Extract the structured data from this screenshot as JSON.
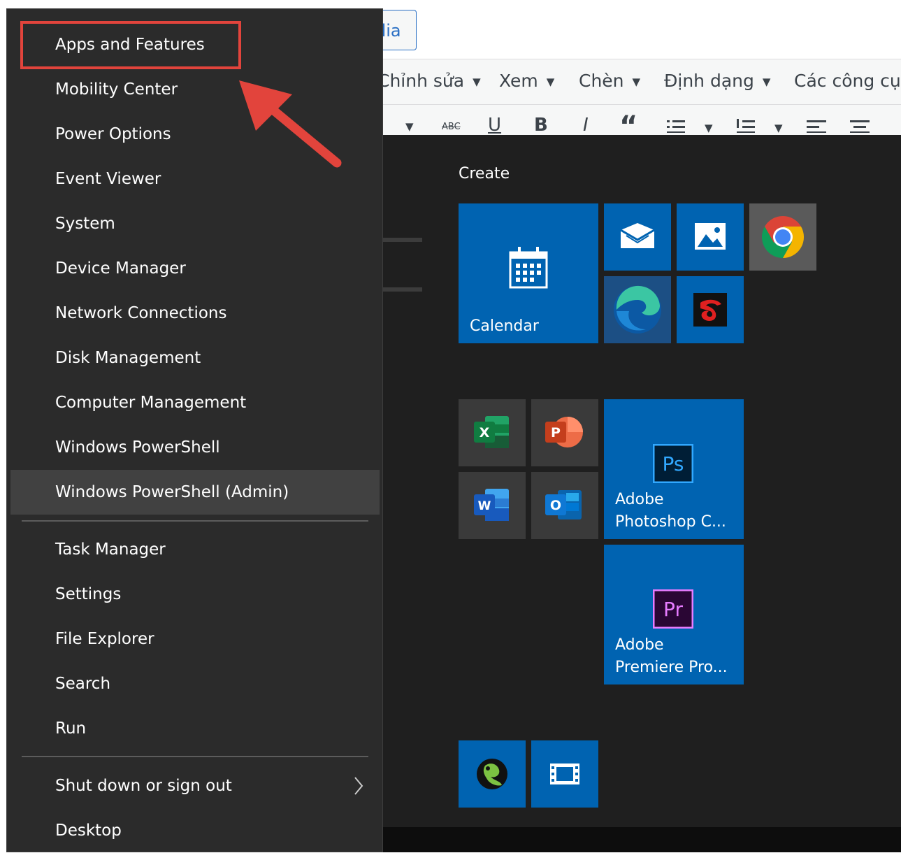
{
  "editor": {
    "media_button": "dia",
    "menu": [
      "Chỉnh sửa",
      "Xem",
      "Chèn",
      "Định dạng",
      "Các công cụ"
    ],
    "toolbar": [
      "ABC",
      "U",
      "B",
      "I",
      "“"
    ]
  },
  "context_menu": {
    "items": [
      {
        "label": "Apps and Features"
      },
      {
        "label": "Mobility Center"
      },
      {
        "label": "Power Options"
      },
      {
        "label": "Event Viewer"
      },
      {
        "label": "System"
      },
      {
        "label": "Device Manager"
      },
      {
        "label": "Network Connections"
      },
      {
        "label": "Disk Management"
      },
      {
        "label": "Computer Management"
      },
      {
        "label": "Windows PowerShell"
      },
      {
        "label": "Windows PowerShell (Admin)"
      },
      {
        "label": "Task Manager"
      },
      {
        "label": "Settings"
      },
      {
        "label": "File Explorer"
      },
      {
        "label": "Search"
      },
      {
        "label": "Run"
      },
      {
        "label": "Shut down or sign out"
      },
      {
        "label": "Desktop"
      }
    ],
    "hovered_item": "Windows PowerShell (Admin)",
    "highlighted_item": "Apps and Features"
  },
  "start_menu": {
    "group_title": "Create",
    "tiles": {
      "calendar": "Calendar",
      "photoshop": [
        "Adobe",
        "Photoshop C..."
      ],
      "premiere": [
        "Adobe",
        "Premiere Pro..."
      ],
      "ps_badge": "Ps",
      "pr_badge": "Pr",
      "excel_letter": "X",
      "powerpoint_letter": "P",
      "word_letter": "W",
      "outlook_letter": "O"
    }
  },
  "colors": {
    "highlight": "#e2443c",
    "tile_blue": "#0063b1",
    "menu_bg": "#2b2b2b"
  }
}
